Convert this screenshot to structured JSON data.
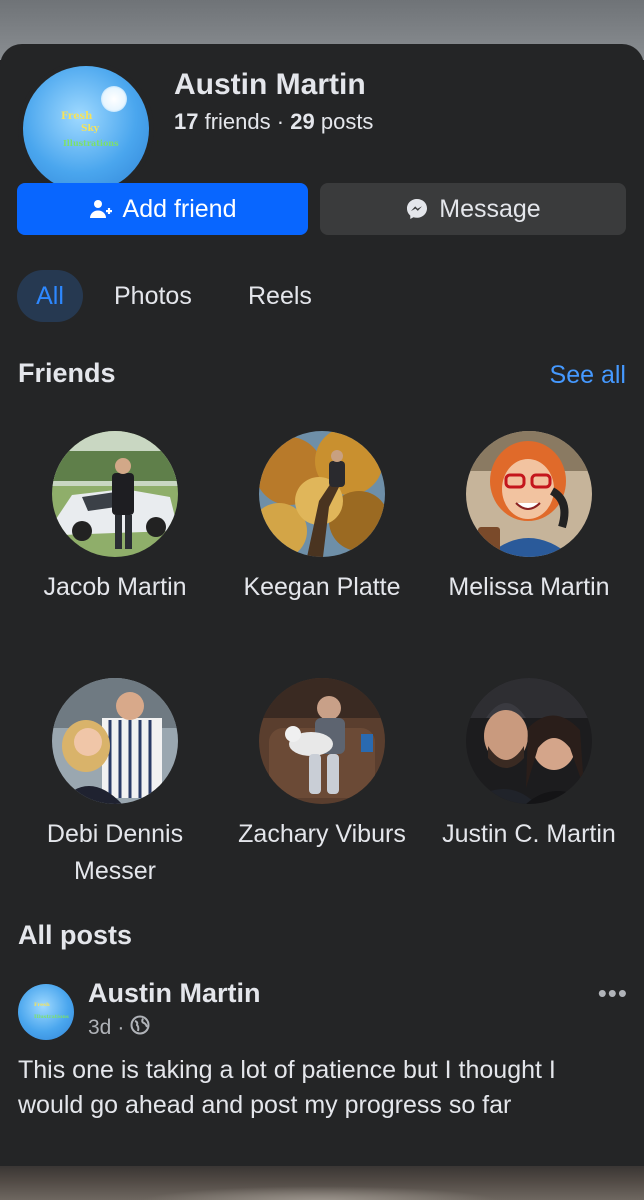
{
  "profile": {
    "name": "Austin Martin",
    "friends_count": "17",
    "friends_label": "friends",
    "separator": "·",
    "posts_count": "29",
    "posts_label": "posts",
    "avatar_logo": {
      "line1": "Fresh",
      "line2": "Sky",
      "line3": "Illustrations"
    }
  },
  "actions": {
    "add_friend_label": "Add friend",
    "message_label": "Message"
  },
  "tabs": [
    {
      "label": "All",
      "active": true
    },
    {
      "label": "Photos",
      "active": false
    },
    {
      "label": "Reels",
      "active": false
    }
  ],
  "friends_section": {
    "title": "Friends",
    "see_all": "See all",
    "friends": [
      {
        "name": "Jacob Martin",
        "icon": "person-with-car-photo"
      },
      {
        "name": "Keegan Platte",
        "icon": "person-in-tree-photo"
      },
      {
        "name": "Melissa Martin",
        "icon": "cartoon-woman-phone-photo"
      },
      {
        "name": "Debi Dennis Messer",
        "icon": "couple-photo"
      },
      {
        "name": "Zachary Viburs",
        "icon": "person-with-dog-photo"
      },
      {
        "name": "Justin C. Martin",
        "icon": "couple-selfie-photo"
      }
    ]
  },
  "posts_section": {
    "title": "All posts",
    "post": {
      "author": "Austin Martin",
      "time": "3d",
      "dot": "·",
      "privacy_icon": "globe-icon",
      "more_label": "•••",
      "text": "This one is taking a lot of patience but I thought I would go ahead and post my progress so far"
    }
  },
  "colors": {
    "accent": "#0866ff",
    "link": "#4599ff",
    "background": "#242526"
  }
}
